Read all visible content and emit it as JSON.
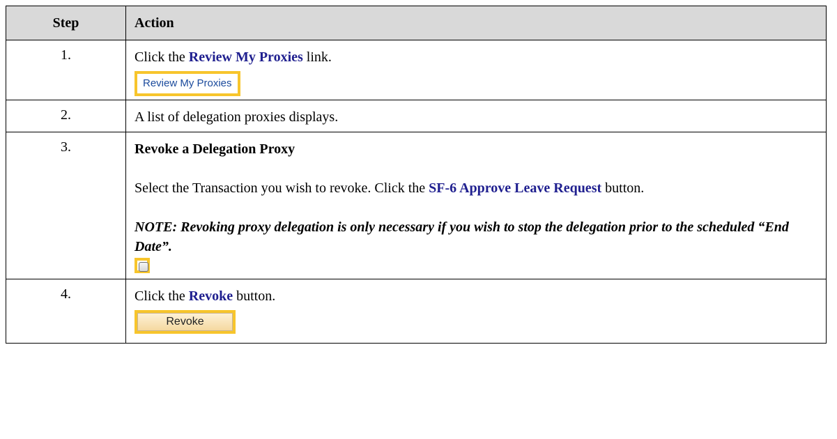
{
  "header": {
    "step": "Step",
    "action": "Action"
  },
  "rows": [
    {
      "step": "1.",
      "text_pre": "Click the ",
      "keyword": "Review My Proxies",
      "text_post": " link.",
      "image_label": "Review My Proxies"
    },
    {
      "step": "2.",
      "text": "A list of delegation proxies displays."
    },
    {
      "step": "3.",
      "heading": "Revoke a Delegation Proxy",
      "text_pre": "Select the Transaction you wish to revoke. Click the ",
      "keyword": "SF-6 Approve Leave Request",
      "text_post": " button.",
      "note": "NOTE: Revoking proxy delegation is only necessary if you wish to stop the delegation prior to the scheduled “End Date”."
    },
    {
      "step": "4.",
      "text_pre": "Click the ",
      "keyword": "Revoke",
      "text_post": " button.",
      "image_label": "Revoke"
    }
  ],
  "colors": {
    "header_bg": "#d9d9d9",
    "keyword": "#1f1f8f",
    "highlight": "#f7c52c"
  }
}
